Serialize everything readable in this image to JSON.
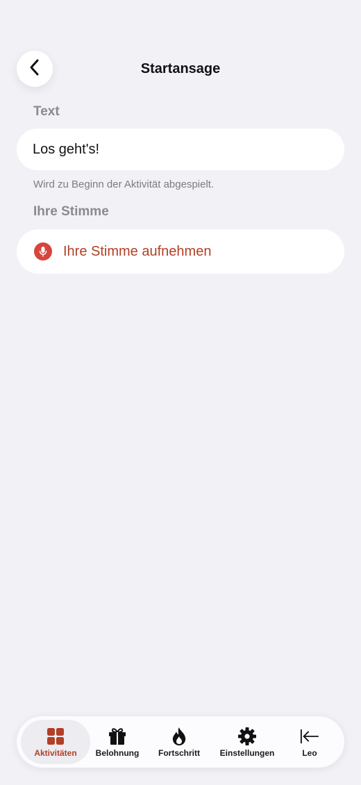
{
  "header": {
    "title": "Startansage",
    "back_icon": "chevron-left-icon"
  },
  "text_section": {
    "label": "Text",
    "value": "Los geht's!",
    "helper": "Wird zu Beginn der Aktivität abgespielt."
  },
  "voice_section": {
    "label": "Ihre Stimme",
    "record_label": "Ihre Stimme aufnehmen",
    "icon": "microphone-icon"
  },
  "tabs": [
    {
      "label": "Aktivitäten",
      "icon": "grid-icon",
      "active": true
    },
    {
      "label": "Belohnung",
      "icon": "gift-icon",
      "active": false
    },
    {
      "label": "Fortschritt",
      "icon": "flame-icon",
      "active": false
    },
    {
      "label": "Einstellungen",
      "icon": "gear-icon",
      "active": false
    },
    {
      "label": "Leo",
      "icon": "arrow-left-bar-icon",
      "active": false
    }
  ],
  "colors": {
    "accent": "#B23F26",
    "mic_badge": "#D6453C",
    "background": "#F2F1F6"
  }
}
